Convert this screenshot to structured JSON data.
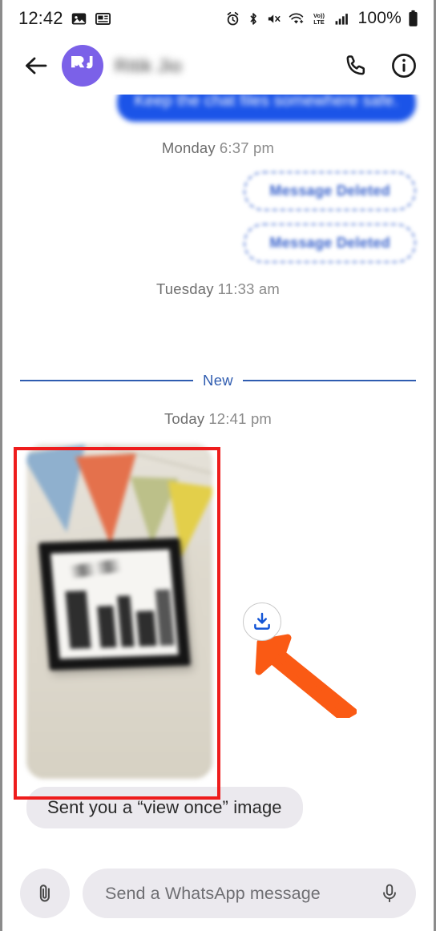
{
  "status_bar": {
    "time": "12:42",
    "battery_percent": "100%",
    "left_icons": [
      "photo-icon",
      "card-icon"
    ],
    "right_icons": [
      "alarm-icon",
      "bluetooth-icon",
      "mute-icon",
      "wifi-icon",
      "volte-icon",
      "signal-icon"
    ]
  },
  "header": {
    "back_label": "back-arrow",
    "avatar_initials": "RJ",
    "contact_name": "Ritik Jio",
    "call_label": "call",
    "info_label": "info"
  },
  "chat": {
    "outgoing_message": "Keep the chat files somewhere safe.",
    "separator_monday": {
      "day": "Monday",
      "time": "6:37 pm"
    },
    "deleted_1": "Message Deleted",
    "deleted_2": "Message Deleted",
    "separator_tuesday": {
      "day": "Tuesday",
      "time": "11:33 am"
    },
    "new_divider_label": "New",
    "separator_today": {
      "day": "Today",
      "time": "12:41 pm"
    },
    "attachment": {
      "download_icon": "download-icon",
      "caption": "Sent you a “view once” image"
    }
  },
  "composer": {
    "attach_icon": "paperclip-icon",
    "placeholder": "Send a WhatsApp message",
    "mic_icon": "microphone-icon"
  },
  "annotation": {
    "highlight_color": "#ee1c1c",
    "arrow_color": "#fa5a14"
  },
  "colors": {
    "outgoing_bubble": "#1b54e8",
    "deleted_border": "#5c7fd6",
    "new_divider": "#2f5cb0",
    "avatar_bg": "#7b61e8",
    "composer_bg": "#ebe9ee"
  }
}
